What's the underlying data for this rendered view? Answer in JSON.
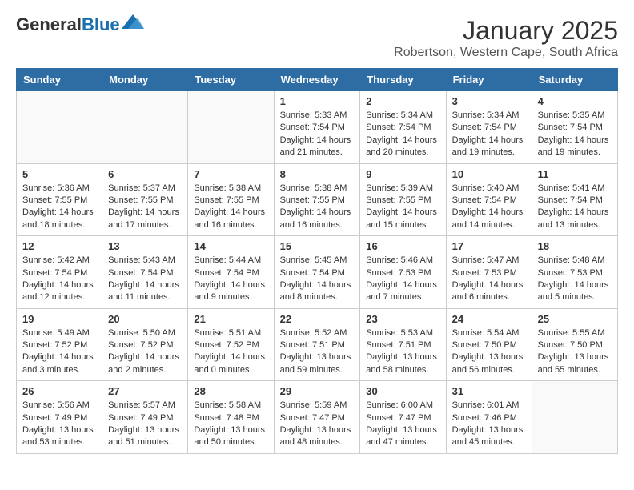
{
  "header": {
    "logo_general": "General",
    "logo_blue": "Blue",
    "month_title": "January 2025",
    "location": "Robertson, Western Cape, South Africa"
  },
  "days_of_week": [
    "Sunday",
    "Monday",
    "Tuesday",
    "Wednesday",
    "Thursday",
    "Friday",
    "Saturday"
  ],
  "weeks": [
    [
      {
        "day": "",
        "info": ""
      },
      {
        "day": "",
        "info": ""
      },
      {
        "day": "",
        "info": ""
      },
      {
        "day": "1",
        "info": "Sunrise: 5:33 AM\nSunset: 7:54 PM\nDaylight: 14 hours\nand 21 minutes."
      },
      {
        "day": "2",
        "info": "Sunrise: 5:34 AM\nSunset: 7:54 PM\nDaylight: 14 hours\nand 20 minutes."
      },
      {
        "day": "3",
        "info": "Sunrise: 5:34 AM\nSunset: 7:54 PM\nDaylight: 14 hours\nand 19 minutes."
      },
      {
        "day": "4",
        "info": "Sunrise: 5:35 AM\nSunset: 7:54 PM\nDaylight: 14 hours\nand 19 minutes."
      }
    ],
    [
      {
        "day": "5",
        "info": "Sunrise: 5:36 AM\nSunset: 7:55 PM\nDaylight: 14 hours\nand 18 minutes."
      },
      {
        "day": "6",
        "info": "Sunrise: 5:37 AM\nSunset: 7:55 PM\nDaylight: 14 hours\nand 17 minutes."
      },
      {
        "day": "7",
        "info": "Sunrise: 5:38 AM\nSunset: 7:55 PM\nDaylight: 14 hours\nand 16 minutes."
      },
      {
        "day": "8",
        "info": "Sunrise: 5:38 AM\nSunset: 7:55 PM\nDaylight: 14 hours\nand 16 minutes."
      },
      {
        "day": "9",
        "info": "Sunrise: 5:39 AM\nSunset: 7:55 PM\nDaylight: 14 hours\nand 15 minutes."
      },
      {
        "day": "10",
        "info": "Sunrise: 5:40 AM\nSunset: 7:54 PM\nDaylight: 14 hours\nand 14 minutes."
      },
      {
        "day": "11",
        "info": "Sunrise: 5:41 AM\nSunset: 7:54 PM\nDaylight: 14 hours\nand 13 minutes."
      }
    ],
    [
      {
        "day": "12",
        "info": "Sunrise: 5:42 AM\nSunset: 7:54 PM\nDaylight: 14 hours\nand 12 minutes."
      },
      {
        "day": "13",
        "info": "Sunrise: 5:43 AM\nSunset: 7:54 PM\nDaylight: 14 hours\nand 11 minutes."
      },
      {
        "day": "14",
        "info": "Sunrise: 5:44 AM\nSunset: 7:54 PM\nDaylight: 14 hours\nand 9 minutes."
      },
      {
        "day": "15",
        "info": "Sunrise: 5:45 AM\nSunset: 7:54 PM\nDaylight: 14 hours\nand 8 minutes."
      },
      {
        "day": "16",
        "info": "Sunrise: 5:46 AM\nSunset: 7:53 PM\nDaylight: 14 hours\nand 7 minutes."
      },
      {
        "day": "17",
        "info": "Sunrise: 5:47 AM\nSunset: 7:53 PM\nDaylight: 14 hours\nand 6 minutes."
      },
      {
        "day": "18",
        "info": "Sunrise: 5:48 AM\nSunset: 7:53 PM\nDaylight: 14 hours\nand 5 minutes."
      }
    ],
    [
      {
        "day": "19",
        "info": "Sunrise: 5:49 AM\nSunset: 7:52 PM\nDaylight: 14 hours\nand 3 minutes."
      },
      {
        "day": "20",
        "info": "Sunrise: 5:50 AM\nSunset: 7:52 PM\nDaylight: 14 hours\nand 2 minutes."
      },
      {
        "day": "21",
        "info": "Sunrise: 5:51 AM\nSunset: 7:52 PM\nDaylight: 14 hours\nand 0 minutes."
      },
      {
        "day": "22",
        "info": "Sunrise: 5:52 AM\nSunset: 7:51 PM\nDaylight: 13 hours\nand 59 minutes."
      },
      {
        "day": "23",
        "info": "Sunrise: 5:53 AM\nSunset: 7:51 PM\nDaylight: 13 hours\nand 58 minutes."
      },
      {
        "day": "24",
        "info": "Sunrise: 5:54 AM\nSunset: 7:50 PM\nDaylight: 13 hours\nand 56 minutes."
      },
      {
        "day": "25",
        "info": "Sunrise: 5:55 AM\nSunset: 7:50 PM\nDaylight: 13 hours\nand 55 minutes."
      }
    ],
    [
      {
        "day": "26",
        "info": "Sunrise: 5:56 AM\nSunset: 7:49 PM\nDaylight: 13 hours\nand 53 minutes."
      },
      {
        "day": "27",
        "info": "Sunrise: 5:57 AM\nSunset: 7:49 PM\nDaylight: 13 hours\nand 51 minutes."
      },
      {
        "day": "28",
        "info": "Sunrise: 5:58 AM\nSunset: 7:48 PM\nDaylight: 13 hours\nand 50 minutes."
      },
      {
        "day": "29",
        "info": "Sunrise: 5:59 AM\nSunset: 7:47 PM\nDaylight: 13 hours\nand 48 minutes."
      },
      {
        "day": "30",
        "info": "Sunrise: 6:00 AM\nSunset: 7:47 PM\nDaylight: 13 hours\nand 47 minutes."
      },
      {
        "day": "31",
        "info": "Sunrise: 6:01 AM\nSunset: 7:46 PM\nDaylight: 13 hours\nand 45 minutes."
      },
      {
        "day": "",
        "info": ""
      }
    ]
  ]
}
